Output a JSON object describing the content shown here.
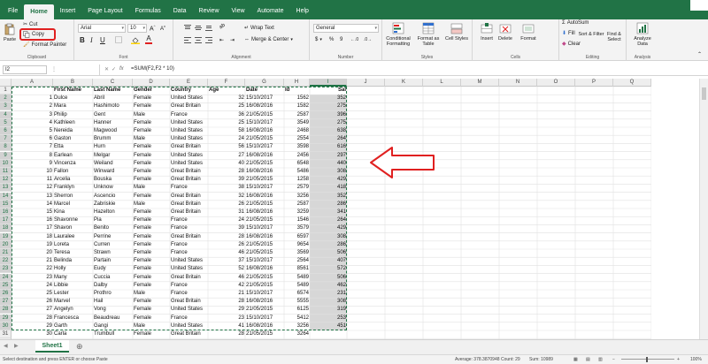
{
  "ribbon_tabs": [
    "File",
    "Home",
    "Insert",
    "Page Layout",
    "Formulas",
    "Data",
    "Review",
    "View",
    "Automate",
    "Help"
  ],
  "active_tab": "Home",
  "clipboard": {
    "cut": "Cut",
    "copy": "Copy",
    "format_painter": "Format Painter",
    "paste": "Paste",
    "label": "Clipboard"
  },
  "font": {
    "name": "Arial",
    "size": "10",
    "label": "Font"
  },
  "alignment": {
    "wrap": "Wrap Text",
    "merge": "Merge & Center",
    "label": "Alignment"
  },
  "number": {
    "format": "General",
    "label": "Number"
  },
  "styles": {
    "conditional": "Conditional Formatting",
    "format_table": "Format as Table",
    "cell_styles": "Cell Styles",
    "label": "Styles"
  },
  "cells_group": {
    "insert": "Insert",
    "delete": "Delete",
    "format": "Format",
    "label": "Cells"
  },
  "editing": {
    "autosum": "AutoSum",
    "fill": "Fill",
    "clear": "Clear",
    "sort": "Sort & Filter",
    "find": "Find & Select",
    "label": "Editing"
  },
  "analysis": {
    "analyze": "Analyze Data",
    "label": "Analysis"
  },
  "name_box": "I2",
  "formula": "=SUM(F2,F2 * 10)",
  "columns": [
    "A",
    "B",
    "C",
    "D",
    "E",
    "F",
    "G",
    "H",
    "I",
    "J",
    "K",
    "L",
    "M",
    "N",
    "O",
    "P",
    "Q"
  ],
  "headers": {
    "b": "First Name",
    "c": "Last Name",
    "d": "Gender",
    "e": "Country",
    "f": "Age",
    "g": "Date",
    "h": "Id",
    "i": "Sal"
  },
  "rows": [
    {
      "n": "2",
      "a": "1",
      "b": "Dulce",
      "c": "Abril",
      "d": "Female",
      "e": "United States",
      "f": "32",
      "g": "15/10/2017",
      "h": "1562",
      "i": "352"
    },
    {
      "n": "3",
      "a": "2",
      "b": "Mara",
      "c": "Hashimoto",
      "d": "Female",
      "e": "Great Britain",
      "f": "25",
      "g": "16/08/2016",
      "h": "1582",
      "i": "275"
    },
    {
      "n": "4",
      "a": "3",
      "b": "Philip",
      "c": "Gent",
      "d": "Male",
      "e": "France",
      "f": "36",
      "g": "21/05/2015",
      "h": "2587",
      "i": "396"
    },
    {
      "n": "5",
      "a": "4",
      "b": "Kathleen",
      "c": "Hanner",
      "d": "Female",
      "e": "United States",
      "f": "25",
      "g": "15/10/2017",
      "h": "3549",
      "i": "275"
    },
    {
      "n": "6",
      "a": "5",
      "b": "Nereida",
      "c": "Magwood",
      "d": "Female",
      "e": "United States",
      "f": "58",
      "g": "16/08/2016",
      "h": "2468",
      "i": "638"
    },
    {
      "n": "7",
      "a": "6",
      "b": "Gaston",
      "c": "Brumm",
      "d": "Male",
      "e": "United States",
      "f": "24",
      "g": "21/05/2015",
      "h": "2554",
      "i": "264"
    },
    {
      "n": "8",
      "a": "7",
      "b": "Etta",
      "c": "Hurn",
      "d": "Female",
      "e": "Great Britain",
      "f": "56",
      "g": "15/10/2017",
      "h": "3598",
      "i": "616"
    },
    {
      "n": "9",
      "a": "8",
      "b": "Earlean",
      "c": "Melgar",
      "d": "Female",
      "e": "United States",
      "f": "27",
      "g": "16/08/2016",
      "h": "2456",
      "i": "297"
    },
    {
      "n": "10",
      "a": "9",
      "b": "Vincenza",
      "c": "Weiland",
      "d": "Female",
      "e": "United States",
      "f": "40",
      "g": "21/05/2015",
      "h": "6548",
      "i": "440"
    },
    {
      "n": "11",
      "a": "10",
      "b": "Fallon",
      "c": "Winward",
      "d": "Female",
      "e": "Great Britain",
      "f": "28",
      "g": "16/08/2016",
      "h": "5486",
      "i": "308"
    },
    {
      "n": "12",
      "a": "11",
      "b": "Arcelia",
      "c": "Bouska",
      "d": "Female",
      "e": "Great Britain",
      "f": "39",
      "g": "21/05/2015",
      "h": "1258",
      "i": "429"
    },
    {
      "n": "13",
      "a": "12",
      "b": "Franklyn",
      "c": "Unknow",
      "d": "Male",
      "e": "France",
      "f": "38",
      "g": "15/10/2017",
      "h": "2579",
      "i": "418"
    },
    {
      "n": "14",
      "a": "13",
      "b": "Sherron",
      "c": "Ascencio",
      "d": "Female",
      "e": "Great Britain",
      "f": "32",
      "g": "16/08/2016",
      "h": "3256",
      "i": "352"
    },
    {
      "n": "15",
      "a": "14",
      "b": "Marcel",
      "c": "Zabriskie",
      "d": "Male",
      "e": "Great Britain",
      "f": "26",
      "g": "21/05/2015",
      "h": "2587",
      "i": "286"
    },
    {
      "n": "16",
      "a": "15",
      "b": "Kina",
      "c": "Hazelton",
      "d": "Female",
      "e": "Great Britain",
      "f": "31",
      "g": "16/08/2016",
      "h": "3259",
      "i": "341"
    },
    {
      "n": "17",
      "a": "16",
      "b": "Shavonne",
      "c": "Pia",
      "d": "Female",
      "e": "France",
      "f": "24",
      "g": "21/05/2015",
      "h": "1546",
      "i": "264"
    },
    {
      "n": "18",
      "a": "17",
      "b": "Shavon",
      "c": "Benito",
      "d": "Female",
      "e": "France",
      "f": "39",
      "g": "15/10/2017",
      "h": "3579",
      "i": "429"
    },
    {
      "n": "19",
      "a": "18",
      "b": "Lauralee",
      "c": "Perrine",
      "d": "Female",
      "e": "Great Britain",
      "f": "28",
      "g": "16/08/2016",
      "h": "6597",
      "i": "308"
    },
    {
      "n": "20",
      "a": "19",
      "b": "Loreta",
      "c": "Curren",
      "d": "Female",
      "e": "France",
      "f": "26",
      "g": "21/05/2015",
      "h": "9654",
      "i": "286"
    },
    {
      "n": "21",
      "a": "20",
      "b": "Teresa",
      "c": "Strawn",
      "d": "Female",
      "e": "France",
      "f": "46",
      "g": "21/05/2015",
      "h": "3569",
      "i": "506"
    },
    {
      "n": "22",
      "a": "21",
      "b": "Belinda",
      "c": "Partain",
      "d": "Female",
      "e": "United States",
      "f": "37",
      "g": "15/10/2017",
      "h": "2564",
      "i": "407"
    },
    {
      "n": "23",
      "a": "22",
      "b": "Holly",
      "c": "Eudy",
      "d": "Female",
      "e": "United States",
      "f": "52",
      "g": "16/08/2016",
      "h": "8561",
      "i": "572"
    },
    {
      "n": "24",
      "a": "23",
      "b": "Many",
      "c": "Cuccia",
      "d": "Female",
      "e": "Great Britain",
      "f": "46",
      "g": "21/05/2015",
      "h": "5489",
      "i": "506"
    },
    {
      "n": "25",
      "a": "24",
      "b": "Libbie",
      "c": "Dalby",
      "d": "Female",
      "e": "France",
      "f": "42",
      "g": "21/05/2015",
      "h": "5489",
      "i": "462"
    },
    {
      "n": "26",
      "a": "25",
      "b": "Lester",
      "c": "Prothro",
      "d": "Male",
      "e": "France",
      "f": "21",
      "g": "15/10/2017",
      "h": "6574",
      "i": "231"
    },
    {
      "n": "27",
      "a": "26",
      "b": "Marvel",
      "c": "Hail",
      "d": "Female",
      "e": "Great Britain",
      "f": "28",
      "g": "16/08/2016",
      "h": "5555",
      "i": "308"
    },
    {
      "n": "28",
      "a": "27",
      "b": "Angelyn",
      "c": "Vong",
      "d": "Female",
      "e": "United States",
      "f": "29",
      "g": "21/05/2015",
      "h": "6125",
      "i": "319"
    },
    {
      "n": "29",
      "a": "28",
      "b": "Francesca",
      "c": "Beaudreau",
      "d": "Female",
      "e": "France",
      "f": "23",
      "g": "15/10/2017",
      "h": "5412",
      "i": "253"
    },
    {
      "n": "30",
      "a": "29",
      "b": "Garth",
      "c": "Gangi",
      "d": "Male",
      "e": "United States",
      "f": "41",
      "g": "16/08/2016",
      "h": "3256",
      "i": "451"
    },
    {
      "n": "31",
      "a": "30",
      "b": "Carla",
      "c": "Trumbull",
      "d": "Female",
      "e": "Great Britain",
      "f": "28",
      "g": "21/05/2015",
      "h": "3264",
      "i": ""
    }
  ],
  "sheet_tab": "Sheet1",
  "status": {
    "left": "Select destination and press ENTER or choose Paste",
    "average": "Average: 378.3870948",
    "count": "Count: 29",
    "sum": "Sum: 10989",
    "zoom": "100%"
  },
  "colors": {
    "accent": "#217346",
    "arrow": "#e02020",
    "selection": "#d7d7d7"
  }
}
